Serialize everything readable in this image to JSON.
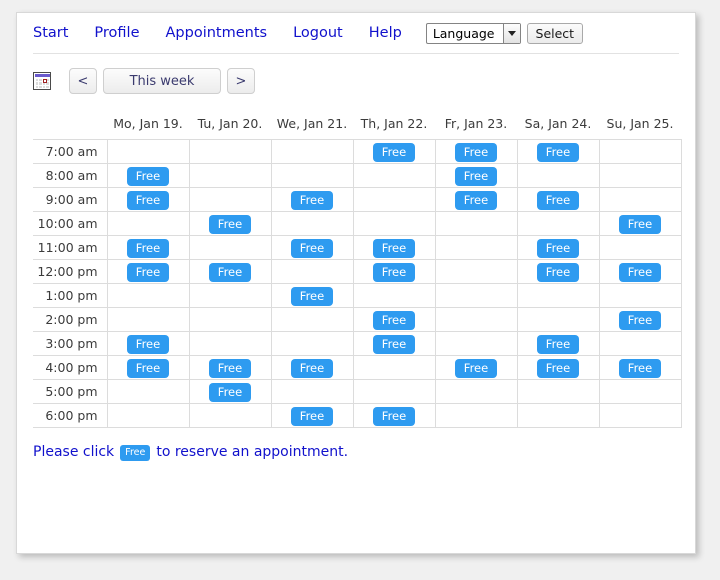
{
  "nav": {
    "links": [
      {
        "label": "Start",
        "name": "nav-link-start"
      },
      {
        "label": "Profile",
        "name": "nav-link-profile"
      },
      {
        "label": "Appointments",
        "name": "nav-link-appointments"
      },
      {
        "label": "Logout",
        "name": "nav-link-logout"
      },
      {
        "label": "Help",
        "name": "nav-link-help"
      }
    ],
    "language_select": {
      "value": "Language",
      "options": [
        "Language"
      ],
      "icon": "chevron-down-icon"
    },
    "select_button": "Select"
  },
  "toolbar": {
    "calendar_icon": "calendar-icon",
    "prev_label": "<",
    "this_week_label": "This week",
    "next_label": ">"
  },
  "schedule": {
    "time_header": "",
    "days": [
      "Mo, Jan 19.",
      "Tu, Jan 20.",
      "We, Jan 21.",
      "Th, Jan 22.",
      "Fr, Jan 23.",
      "Sa, Jan 24.",
      "Su, Jan 25."
    ],
    "times": [
      "7:00 am",
      "8:00 am",
      "9:00 am",
      "10:00 am",
      "11:00 am",
      "12:00 pm",
      "1:00 pm",
      "2:00 pm",
      "3:00 pm",
      "4:00 pm",
      "5:00 pm",
      "6:00 pm"
    ],
    "free_label": "Free",
    "slots": [
      [
        0,
        0,
        0,
        1,
        1,
        1,
        0
      ],
      [
        1,
        0,
        0,
        0,
        1,
        0,
        0
      ],
      [
        1,
        0,
        1,
        0,
        1,
        1,
        0
      ],
      [
        0,
        1,
        0,
        0,
        0,
        0,
        1
      ],
      [
        1,
        0,
        1,
        1,
        0,
        1,
        0
      ],
      [
        1,
        1,
        0,
        1,
        0,
        1,
        1
      ],
      [
        0,
        0,
        1,
        0,
        0,
        0,
        0
      ],
      [
        0,
        0,
        0,
        1,
        0,
        0,
        1
      ],
      [
        1,
        0,
        0,
        1,
        0,
        1,
        0
      ],
      [
        1,
        1,
        1,
        0,
        1,
        1,
        1
      ],
      [
        0,
        1,
        0,
        0,
        0,
        0,
        0
      ],
      [
        0,
        0,
        1,
        1,
        0,
        0,
        0
      ]
    ]
  },
  "footer": {
    "text_before": "Please click",
    "badge_label": "Free",
    "text_after": "to reserve an appointment."
  },
  "colors": {
    "free_blue": "#2e9bf0",
    "link_blue": "#1111cc",
    "grid_line": "#dcdcdc"
  }
}
